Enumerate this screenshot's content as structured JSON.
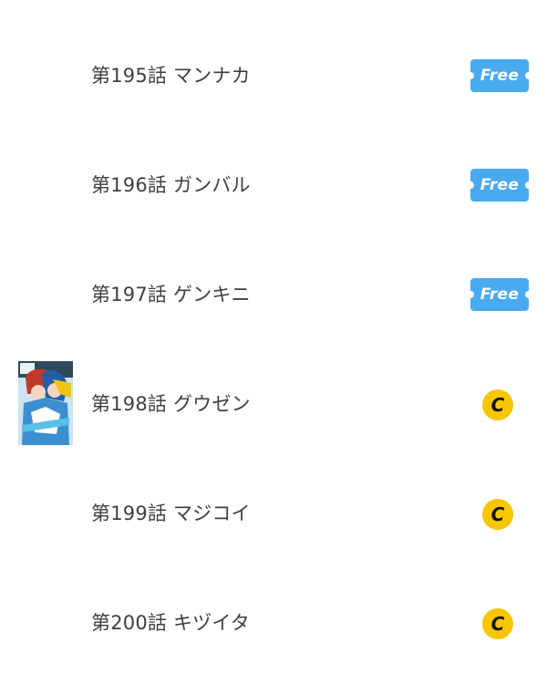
{
  "episodes": [
    {
      "title": "第195話 マンナカ",
      "badge": "Free"
    },
    {
      "title": "第196話 ガンバル",
      "badge": "Free"
    },
    {
      "title": "第197話 ゲンキニ",
      "badge": "Free"
    },
    {
      "title": "第198話 グウゼン",
      "badge": "C",
      "thumbnail": "cover-thumbnail"
    },
    {
      "title": "第199話 マジコイ",
      "badge": "C"
    },
    {
      "title": "第200話 キヅイタ",
      "badge": "C"
    }
  ],
  "colors": {
    "free_badge": "#4aaaf0",
    "coin_badge": "#f7c600",
    "title_text": "#3f3f3f"
  },
  "icons": {
    "free": "ticket-free-icon",
    "coin": "coin-icon"
  }
}
